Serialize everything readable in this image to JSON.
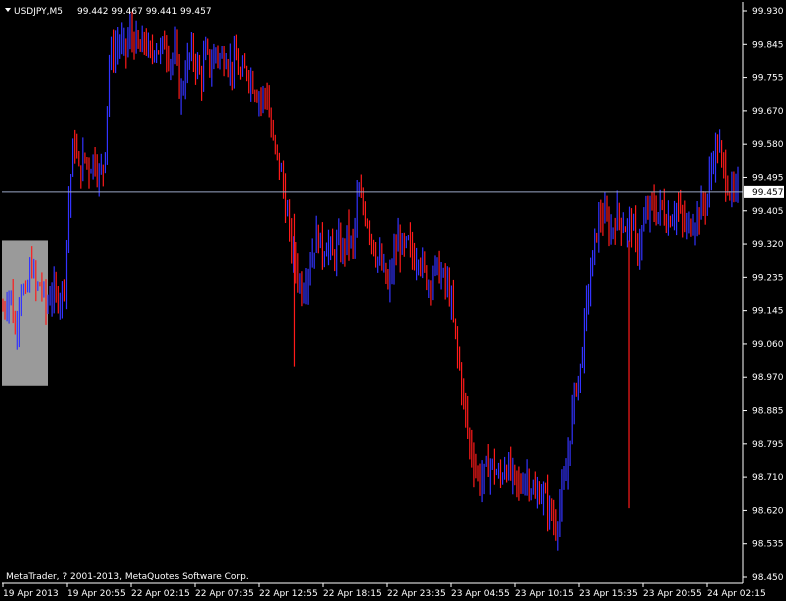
{
  "header": {
    "symbol": "USDJPY,M5",
    "ohlc": "99.442 99.467 99.441 99.457"
  },
  "footer": {
    "copyright": "MetaTrader, ? 2001-2013, MetaQuotes Software Corp."
  },
  "colors": {
    "background": "#000000",
    "axis": "#ffffff",
    "bull": "#3333ff",
    "bear": "#ff1a1a",
    "price_line": "#9aa7c7",
    "price_tag_bg": "#ffffff",
    "price_tag_text": "#000000",
    "box_fill": "#9a9a9a"
  },
  "chart_data": {
    "type": "line",
    "title": "USDJPY,M5",
    "grid": false,
    "ylim": [
      98.45,
      99.93
    ],
    "y_ticks": [
      "99.930",
      "99.845",
      "99.755",
      "99.670",
      "99.580",
      "99.495",
      "99.405",
      "99.320",
      "99.235",
      "99.145",
      "99.060",
      "98.970",
      "98.885",
      "98.795",
      "98.710",
      "98.620",
      "98.535",
      "98.450"
    ],
    "x_ticks": [
      "19 Apr 2013",
      "19 Apr 20:55",
      "22 Apr 02:15",
      "22 Apr 07:35",
      "22 Apr 12:55",
      "22 Apr 18:15",
      "22 Apr 23:35",
      "23 Apr 04:55",
      "23 Apr 10:15",
      "23 Apr 15:35",
      "23 Apr 20:55",
      "24 Apr 02:15"
    ],
    "current_price": 99.457,
    "current_price_label": "99.457",
    "selection_box": {
      "x_from": "19 Apr 2013",
      "y_range": [
        98.95,
        99.33
      ]
    },
    "series": [
      {
        "anchors": [
          [
            0,
            99.15
          ],
          [
            3,
            99.2
          ],
          [
            5,
            99.08
          ],
          [
            7,
            99.22
          ],
          [
            9,
            99.17
          ],
          [
            11,
            99.28
          ],
          [
            13,
            99.2
          ],
          [
            15,
            99.22
          ],
          [
            17,
            99.15
          ],
          [
            19,
            99.2
          ],
          [
            21,
            99.18
          ],
          [
            24,
            99.2
          ],
          [
            26,
            99.45
          ],
          [
            28,
            99.6
          ],
          [
            30,
            99.5
          ],
          [
            32,
            99.55
          ],
          [
            34,
            99.52
          ],
          [
            36,
            99.55
          ],
          [
            38,
            99.5
          ],
          [
            40,
            99.53
          ],
          [
            42,
            99.8
          ],
          [
            44,
            99.83
          ],
          [
            46,
            99.85
          ],
          [
            48,
            99.82
          ],
          [
            50,
            99.87
          ],
          [
            52,
            99.85
          ],
          [
            54,
            99.82
          ],
          [
            56,
            99.86
          ],
          [
            58,
            99.8
          ],
          [
            60,
            99.85
          ],
          [
            62,
            99.82
          ],
          [
            64,
            99.85
          ],
          [
            66,
            99.8
          ],
          [
            68,
            99.82
          ],
          [
            70,
            99.7
          ],
          [
            72,
            99.78
          ],
          [
            74,
            99.82
          ],
          [
            76,
            99.8
          ],
          [
            78,
            99.75
          ],
          [
            80,
            99.82
          ],
          [
            82,
            99.78
          ],
          [
            84,
            99.83
          ],
          [
            86,
            99.8
          ],
          [
            88,
            99.82
          ],
          [
            90,
            99.78
          ],
          [
            92,
            99.8
          ],
          [
            94,
            99.75
          ],
          [
            96,
            99.78
          ],
          [
            98,
            99.75
          ],
          [
            100,
            99.72
          ],
          [
            102,
            99.7
          ],
          [
            104,
            99.72
          ],
          [
            106,
            99.6
          ],
          [
            108,
            99.55
          ],
          [
            110,
            99.5
          ],
          [
            112,
            99.4
          ],
          [
            114,
            99.3
          ],
          [
            116,
            99.25
          ],
          [
            118,
            99.2
          ],
          [
            120,
            99.25
          ],
          [
            122,
            99.3
          ],
          [
            124,
            99.35
          ],
          [
            126,
            99.3
          ],
          [
            128,
            99.33
          ],
          [
            130,
            99.28
          ],
          [
            132,
            99.32
          ],
          [
            134,
            99.3
          ],
          [
            136,
            99.35
          ],
          [
            138,
            99.3
          ],
          [
            140,
            99.45
          ],
          [
            142,
            99.42
          ],
          [
            144,
            99.38
          ],
          [
            146,
            99.32
          ],
          [
            148,
            99.28
          ],
          [
            150,
            99.25
          ],
          [
            152,
            99.2
          ],
          [
            154,
            99.28
          ],
          [
            156,
            99.33
          ],
          [
            158,
            99.3
          ],
          [
            160,
            99.32
          ],
          [
            162,
            99.28
          ],
          [
            164,
            99.3
          ],
          [
            166,
            99.25
          ],
          [
            168,
            99.22
          ],
          [
            170,
            99.26
          ],
          [
            172,
            99.25
          ],
          [
            174,
            99.22
          ],
          [
            176,
            99.2
          ],
          [
            178,
            99.1
          ],
          [
            180,
            99.0
          ],
          [
            182,
            98.9
          ],
          [
            184,
            98.8
          ],
          [
            186,
            98.75
          ],
          [
            188,
            98.7
          ],
          [
            190,
            98.72
          ],
          [
            192,
            98.75
          ],
          [
            194,
            98.73
          ],
          [
            196,
            98.7
          ],
          [
            198,
            98.75
          ],
          [
            200,
            98.72
          ],
          [
            202,
            98.7
          ],
          [
            204,
            98.68
          ],
          [
            206,
            98.72
          ],
          [
            208,
            98.7
          ],
          [
            210,
            98.65
          ],
          [
            212,
            98.68
          ],
          [
            214,
            98.65
          ],
          [
            216,
            98.62
          ],
          [
            218,
            98.58
          ],
          [
            220,
            98.65
          ],
          [
            222,
            98.7
          ],
          [
            224,
            98.85
          ],
          [
            226,
            98.95
          ],
          [
            228,
            99.0
          ],
          [
            230,
            99.15
          ],
          [
            232,
            99.25
          ],
          [
            234,
            99.35
          ],
          [
            236,
            99.4
          ],
          [
            238,
            99.38
          ],
          [
            240,
            99.35
          ],
          [
            242,
            99.4
          ],
          [
            244,
            99.38
          ],
          [
            246,
            99.36
          ],
          [
            248,
            99.38
          ],
          [
            250,
            99.3
          ],
          [
            252,
            99.35
          ],
          [
            254,
            99.4
          ],
          [
            256,
            99.42
          ],
          [
            258,
            99.4
          ],
          [
            260,
            99.42
          ],
          [
            262,
            99.38
          ],
          [
            264,
            99.4
          ],
          [
            266,
            99.42
          ],
          [
            268,
            99.38
          ],
          [
            270,
            99.36
          ],
          [
            272,
            99.38
          ],
          [
            274,
            99.4
          ],
          [
            276,
            99.42
          ],
          [
            278,
            99.45
          ],
          [
            280,
            99.55
          ],
          [
            282,
            99.58
          ],
          [
            284,
            99.52
          ],
          [
            286,
            99.48
          ],
          [
            288,
            99.44
          ],
          [
            290,
            99.46
          ]
        ]
      }
    ]
  }
}
